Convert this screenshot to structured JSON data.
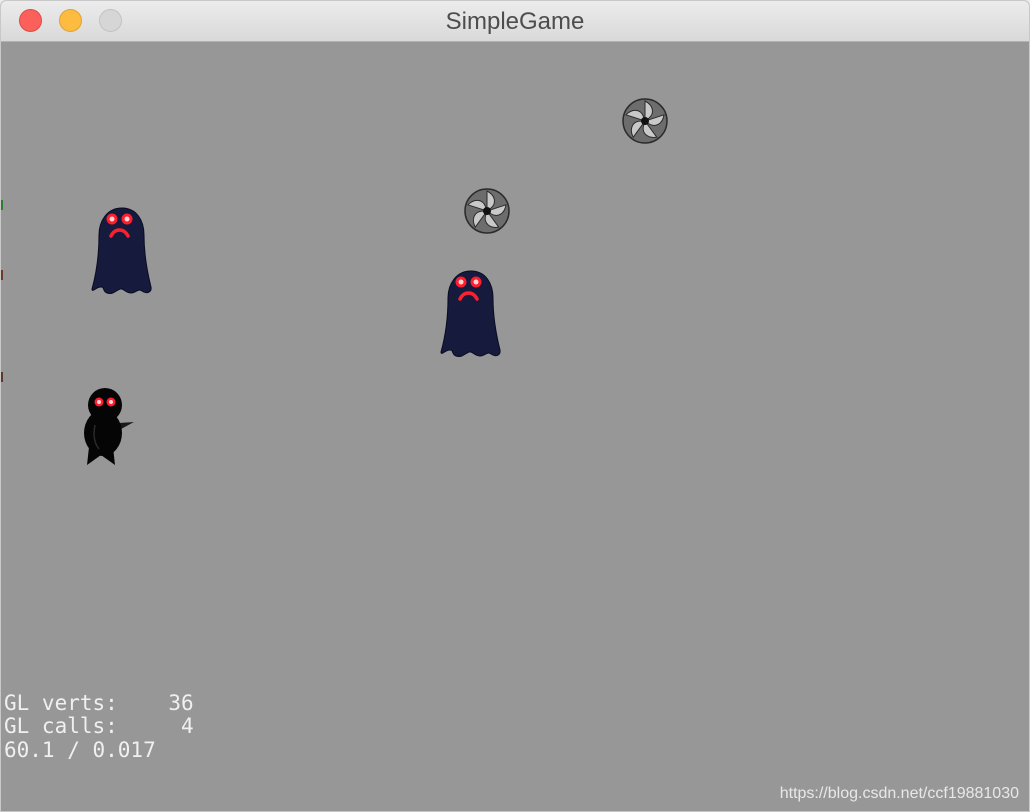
{
  "window": {
    "title": "SimpleGame"
  },
  "scene": {
    "background_color": "#979797",
    "sprites": [
      {
        "kind": "player",
        "icon": "ninja-player-icon"
      },
      {
        "kind": "monster",
        "icon": "ghost-monster-icon"
      },
      {
        "kind": "monster",
        "icon": "ghost-monster-icon"
      },
      {
        "kind": "projectile",
        "icon": "shuriken-icon"
      },
      {
        "kind": "projectile",
        "icon": "shuriken-icon"
      }
    ]
  },
  "stats": {
    "verts_label": "GL verts:",
    "verts_value": "36",
    "calls_label": "GL calls:",
    "calls_value": "4",
    "fps_line": "60.1 / 0.017"
  },
  "watermark": "https://blog.csdn.net/ccf19881030",
  "colors": {
    "close": "#fc605b",
    "minimize": "#fdbc40",
    "zoom": "#d6d6d6",
    "monster_body": "#161a3c",
    "eye_red": "#ff1e2e"
  }
}
